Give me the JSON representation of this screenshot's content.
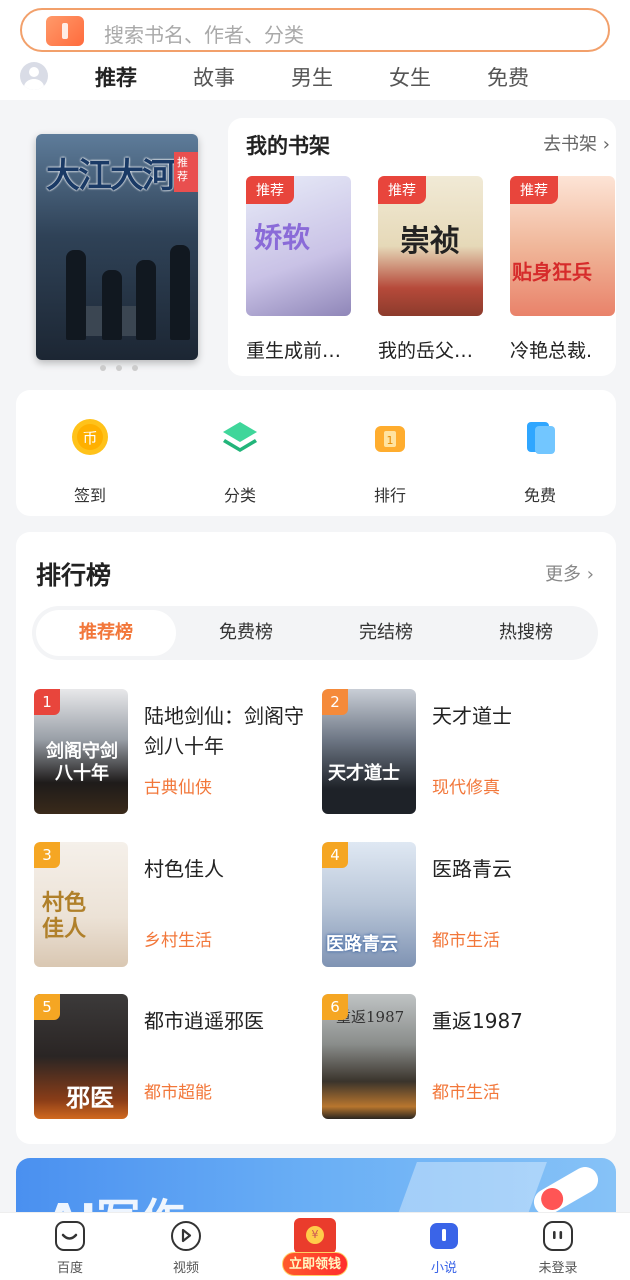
{
  "search": {
    "placeholder": "搜索书名、作者、分类"
  },
  "top_tabs": [
    "推荐",
    "故事",
    "男生",
    "女生",
    "免费"
  ],
  "banner": {
    "cover_title": "大江大河",
    "cover_tag": "推荐"
  },
  "shelf": {
    "title": "我的书架",
    "more_label": "去书架",
    "books": [
      {
        "name": "重生成前…",
        "badge": "推荐",
        "cover_text": "娇软"
      },
      {
        "name": "我的岳父…",
        "badge": "推荐",
        "cover_text": "崇祯"
      },
      {
        "name": "冷艳总裁.",
        "badge": "推荐",
        "cover_text": "贴身狂兵"
      }
    ]
  },
  "quick_actions": [
    {
      "label": "签到",
      "icon": "coin-icon"
    },
    {
      "label": "分类",
      "icon": "layers-icon"
    },
    {
      "label": "排行",
      "icon": "trophy-icon"
    },
    {
      "label": "免费",
      "icon": "book-icon"
    }
  ],
  "ranking": {
    "title": "排行榜",
    "more_label": "更多",
    "tabs": [
      "推荐榜",
      "免费榜",
      "完结榜",
      "热搜榜"
    ],
    "items": [
      {
        "rank": "1",
        "name": "陆地剑仙：剑阁守剑八十年",
        "genre": "古典仙侠",
        "cover_text": "剑阁守剑 八十年"
      },
      {
        "rank": "2",
        "name": "天才道士",
        "genre": "现代修真",
        "cover_text": "天才道士"
      },
      {
        "rank": "3",
        "name": "村色佳人",
        "genre": "乡村生活",
        "cover_text": "村色 佳人"
      },
      {
        "rank": "4",
        "name": "医路青云",
        "genre": "都市生活",
        "cover_text": "医路青云"
      },
      {
        "rank": "5",
        "name": "都市逍遥邪医",
        "genre": "都市超能",
        "cover_text": "邪医"
      },
      {
        "rank": "6",
        "name": "重返1987",
        "genre": "都市生活",
        "cover_text": "重返1987"
      }
    ]
  },
  "ai_card": {
    "text": "AI写作"
  },
  "bottom_nav": [
    {
      "label": "百度"
    },
    {
      "label": "视频"
    },
    {
      "label": "立即领钱"
    },
    {
      "label": "小说"
    },
    {
      "label": "未登录"
    }
  ],
  "colors": {
    "accent": "#f2773a",
    "active_nav": "#3a64e8",
    "badge_red": "#e8453c"
  }
}
